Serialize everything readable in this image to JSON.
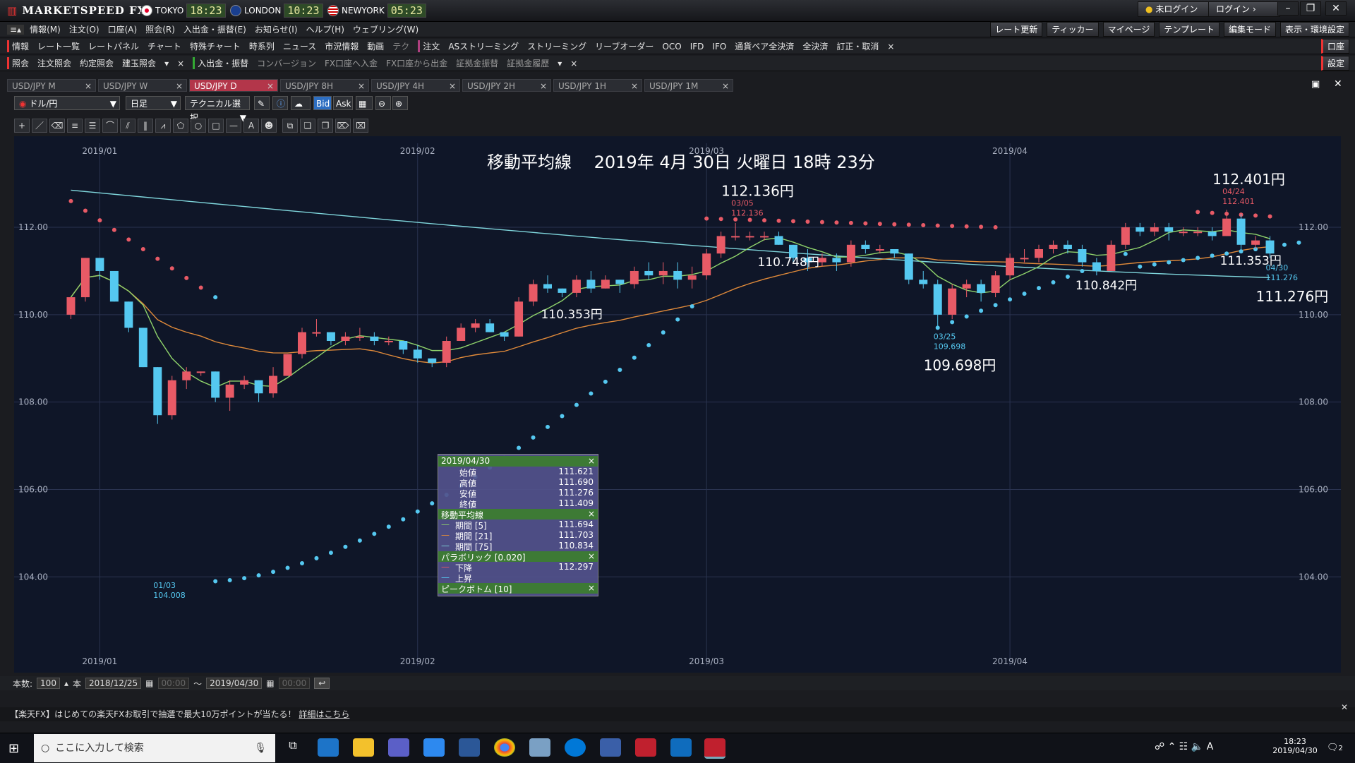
{
  "app": {
    "brand": "MARKETSPEED FX",
    "clocks": [
      {
        "city": "TOKYO",
        "time": "18:23",
        "flag_color": "#e4002b"
      },
      {
        "city": "LONDON",
        "time": "10:23",
        "flag_color": "#1a3f8f"
      },
      {
        "city": "NEWYORK",
        "time": "05:23",
        "flag_color": "#2c52a0"
      }
    ],
    "status": "未ログイン",
    "login": "ログイン",
    "win_controls": [
      "–",
      "❐",
      "✕"
    ]
  },
  "menu": {
    "items": [
      "情報(M)",
      "注文(O)",
      "口座(A)",
      "照会(R)",
      "入出金・振替(E)",
      "お知らせ(I)",
      "ヘルプ(H)",
      "ウェブリング(W)"
    ],
    "right": [
      "レート更新",
      "ティッカー",
      "マイページ",
      "テンプレート",
      "編集モード",
      "表示・環境設定"
    ]
  },
  "toolbar1": {
    "left": [
      "情報",
      "レート一覧",
      "レートパネル",
      "チャート",
      "特殊チャート",
      "時系列",
      "ニュース",
      "市況情報",
      "動画",
      "テク"
    ],
    "orders": [
      "注文",
      "ASストリーミング",
      "ストリーミング",
      "リーブオーダー",
      "OCO",
      "IFD",
      "IFO",
      "通貨ペア全決済",
      "全決済",
      "訂正・取消"
    ],
    "right": "口座"
  },
  "toolbar2": {
    "left": [
      "照会",
      "注文照会",
      "約定照会",
      "建玉照会"
    ],
    "mid": [
      "入出金・振替",
      "コンバージョン",
      "FX口座へ入金",
      "FX口座から出金",
      "証拠金振替",
      "証拠金履歴"
    ],
    "right": "設定"
  },
  "tabs": [
    "USD/JPY M",
    "USD/JPY W",
    "USD/JPY D",
    "USD/JPY 8H",
    "USD/JPY 4H",
    "USD/JPY 2H",
    "USD/JPY 1H",
    "USD/JPY 1M"
  ],
  "active_tab": 2,
  "chart_toolbar": {
    "pair": "ドル/円",
    "period": "日足",
    "technical": "テクニカル選択",
    "bid": "Bid",
    "ask": "Ask"
  },
  "chart_title": "移動平均線　 2019年 4月 30日 火曜日 18時 23分",
  "chart_data": {
    "type": "candlestick",
    "y_ticks": [
      "104.00",
      "106.00",
      "108.00",
      "110.00",
      "112.00"
    ],
    "ylim": [
      103.1,
      113.6
    ],
    "x_months": [
      "2019/01",
      "2019/02",
      "2019/03",
      "2019/04"
    ],
    "annotations": [
      {
        "label": "112.136円",
        "date": "03/05",
        "price": "112.136"
      },
      {
        "label": "112.401円",
        "date": "04/24",
        "price": "112.401"
      },
      {
        "label": "109.698円",
        "date": "03/25",
        "price": "109.698"
      },
      {
        "label": "111.276円",
        "date": "04/30",
        "price": "111.276"
      },
      {
        "label": "",
        "date": "01/03",
        "price": "104.008"
      },
      {
        "label": "110.353円"
      },
      {
        "label": "110.748円"
      },
      {
        "label": "110.842円"
      },
      {
        "label": "111.353円"
      }
    ],
    "candles": [
      [
        110.0,
        110.4,
        109.9,
        110.4
      ],
      [
        110.4,
        111.3,
        110.3,
        111.3
      ],
      [
        111.3,
        111.3,
        110.8,
        111.0
      ],
      [
        111.0,
        111.0,
        110.3,
        110.3
      ],
      [
        110.3,
        110.3,
        109.6,
        109.7
      ],
      [
        109.7,
        109.7,
        108.8,
        108.8
      ],
      [
        108.8,
        108.8,
        107.5,
        107.7
      ],
      [
        107.7,
        108.6,
        107.6,
        108.5
      ],
      [
        108.5,
        108.8,
        108.3,
        108.7
      ],
      [
        108.7,
        108.7,
        108.6,
        108.7
      ],
      [
        108.7,
        108.7,
        108.0,
        108.1
      ],
      [
        108.1,
        108.5,
        107.8,
        108.4
      ],
      [
        108.4,
        108.6,
        108.3,
        108.5
      ],
      [
        108.5,
        108.5,
        108.0,
        108.2
      ],
      [
        108.2,
        108.8,
        108.1,
        108.6
      ],
      [
        108.6,
        109.1,
        108.6,
        109.1
      ],
      [
        109.1,
        109.7,
        109.0,
        109.6
      ],
      [
        109.6,
        109.9,
        109.5,
        109.6
      ],
      [
        109.6,
        109.6,
        109.3,
        109.4
      ],
      [
        109.4,
        109.6,
        109.3,
        109.5
      ],
      [
        109.5,
        109.7,
        109.4,
        109.5
      ],
      [
        109.5,
        109.6,
        109.3,
        109.4
      ],
      [
        109.4,
        109.5,
        109.3,
        109.4
      ],
      [
        109.4,
        109.4,
        109.1,
        109.2
      ],
      [
        109.2,
        109.3,
        108.9,
        109.0
      ],
      [
        109.0,
        109.0,
        108.8,
        108.9
      ],
      [
        108.9,
        109.5,
        108.8,
        109.4
      ],
      [
        109.4,
        109.8,
        109.4,
        109.7
      ],
      [
        109.7,
        109.9,
        109.6,
        109.8
      ],
      [
        109.8,
        109.9,
        109.6,
        109.6
      ],
      [
        109.6,
        109.6,
        109.4,
        109.5
      ],
      [
        109.5,
        110.4,
        109.5,
        110.3
      ],
      [
        110.3,
        110.8,
        110.2,
        110.7
      ],
      [
        110.7,
        110.9,
        110.5,
        110.6
      ],
      [
        110.6,
        110.6,
        110.4,
        110.5
      ],
      [
        110.5,
        110.9,
        110.4,
        110.8
      ],
      [
        110.8,
        111.0,
        110.5,
        110.6
      ],
      [
        110.6,
        110.9,
        110.6,
        110.8
      ],
      [
        110.8,
        110.8,
        110.5,
        110.7
      ],
      [
        110.7,
        111.1,
        110.6,
        111.0
      ],
      [
        111.0,
        111.2,
        110.8,
        110.9
      ],
      [
        110.9,
        111.2,
        110.7,
        111.0
      ],
      [
        111.0,
        111.2,
        110.6,
        110.8
      ],
      [
        110.8,
        111.1,
        110.6,
        110.9
      ],
      [
        110.9,
        111.5,
        110.8,
        111.4
      ],
      [
        111.4,
        111.9,
        111.3,
        111.8
      ],
      [
        111.8,
        112.1,
        111.7,
        111.8
      ],
      [
        111.8,
        111.9,
        111.7,
        111.8
      ],
      [
        111.8,
        111.9,
        111.7,
        111.8
      ],
      [
        111.8,
        111.9,
        111.6,
        111.6
      ],
      [
        111.6,
        111.6,
        111.2,
        111.3
      ],
      [
        111.3,
        111.5,
        111.0,
        111.2
      ],
      [
        111.2,
        111.4,
        111.1,
        111.3
      ],
      [
        111.3,
        111.4,
        111.0,
        111.2
      ],
      [
        111.2,
        111.7,
        111.1,
        111.6
      ],
      [
        111.6,
        111.7,
        111.4,
        111.5
      ],
      [
        111.5,
        111.6,
        111.4,
        111.5
      ],
      [
        111.5,
        111.5,
        111.3,
        111.4
      ],
      [
        111.4,
        111.4,
        110.7,
        110.8
      ],
      [
        110.8,
        111.0,
        110.6,
        110.7
      ],
      [
        110.7,
        110.8,
        109.7,
        110.0
      ],
      [
        110.0,
        110.7,
        109.9,
        110.6
      ],
      [
        110.6,
        110.8,
        110.4,
        110.7
      ],
      [
        110.7,
        110.8,
        110.3,
        110.5
      ],
      [
        110.5,
        111.0,
        110.4,
        110.9
      ],
      [
        110.9,
        111.4,
        110.8,
        111.3
      ],
      [
        111.3,
        111.5,
        111.2,
        111.3
      ],
      [
        111.3,
        111.6,
        111.2,
        111.5
      ],
      [
        111.5,
        111.7,
        111.4,
        111.6
      ],
      [
        111.6,
        111.7,
        111.4,
        111.5
      ],
      [
        111.5,
        111.6,
        111.1,
        111.2
      ],
      [
        111.2,
        111.3,
        110.9,
        111.0
      ],
      [
        111.0,
        111.7,
        111.0,
        111.6
      ],
      [
        111.6,
        112.1,
        111.5,
        112.0
      ],
      [
        112.0,
        112.1,
        111.8,
        111.9
      ],
      [
        111.9,
        112.1,
        111.8,
        112.0
      ],
      [
        112.0,
        112.1,
        111.7,
        111.9
      ],
      [
        111.9,
        112.0,
        111.8,
        111.9
      ],
      [
        111.9,
        112.0,
        111.8,
        111.9
      ],
      [
        111.9,
        112.0,
        111.7,
        111.8
      ],
      [
        111.8,
        112.4,
        111.8,
        112.2
      ],
      [
        112.2,
        112.3,
        111.5,
        111.6
      ],
      [
        111.6,
        111.8,
        111.5,
        111.7
      ],
      [
        111.7,
        111.8,
        111.3,
        111.4
      ]
    ]
  },
  "info_panel": {
    "date": "2019/04/30",
    "ohlc": [
      [
        "始値",
        "111.621"
      ],
      [
        "高値",
        "111.690"
      ],
      [
        "安値",
        "111.276"
      ],
      [
        "終値",
        "111.409"
      ]
    ],
    "ma_title": "移動平均線",
    "ma": [
      [
        "期間 [5]",
        "111.694"
      ],
      [
        "期間 [21]",
        "111.703"
      ],
      [
        "期間 [75]",
        "110.834"
      ]
    ],
    "sar_title": "パラボリック [0.020]",
    "sar": [
      [
        "下降",
        "112.297"
      ],
      [
        "上昇",
        ""
      ]
    ],
    "pb_title": "ピークボトム [10]"
  },
  "bottombar": {
    "count_label": "本数:",
    "count": "100",
    "unit": "本",
    "from": "2018/12/25",
    "from_time": "00:00",
    "tilde": "～",
    "to": "2019/04/30",
    "to_time": "00:00"
  },
  "ad": "【楽天FX】はじめての楽天FXお取引で抽選で最大10万ポイントが当たる！",
  "ad_link": "詳細はこちら",
  "taskbar": {
    "search_placeholder": "ここに入力して検索",
    "time": "18:23",
    "date": "2019/04/30",
    "notif": "2"
  },
  "colors": {
    "up": "#e85a66",
    "down": "#55c8f0",
    "ma5": "#8fd36b",
    "ma21": "#e08a3a",
    "ma75": "#7fd6dc",
    "bg": "#0f1628"
  }
}
